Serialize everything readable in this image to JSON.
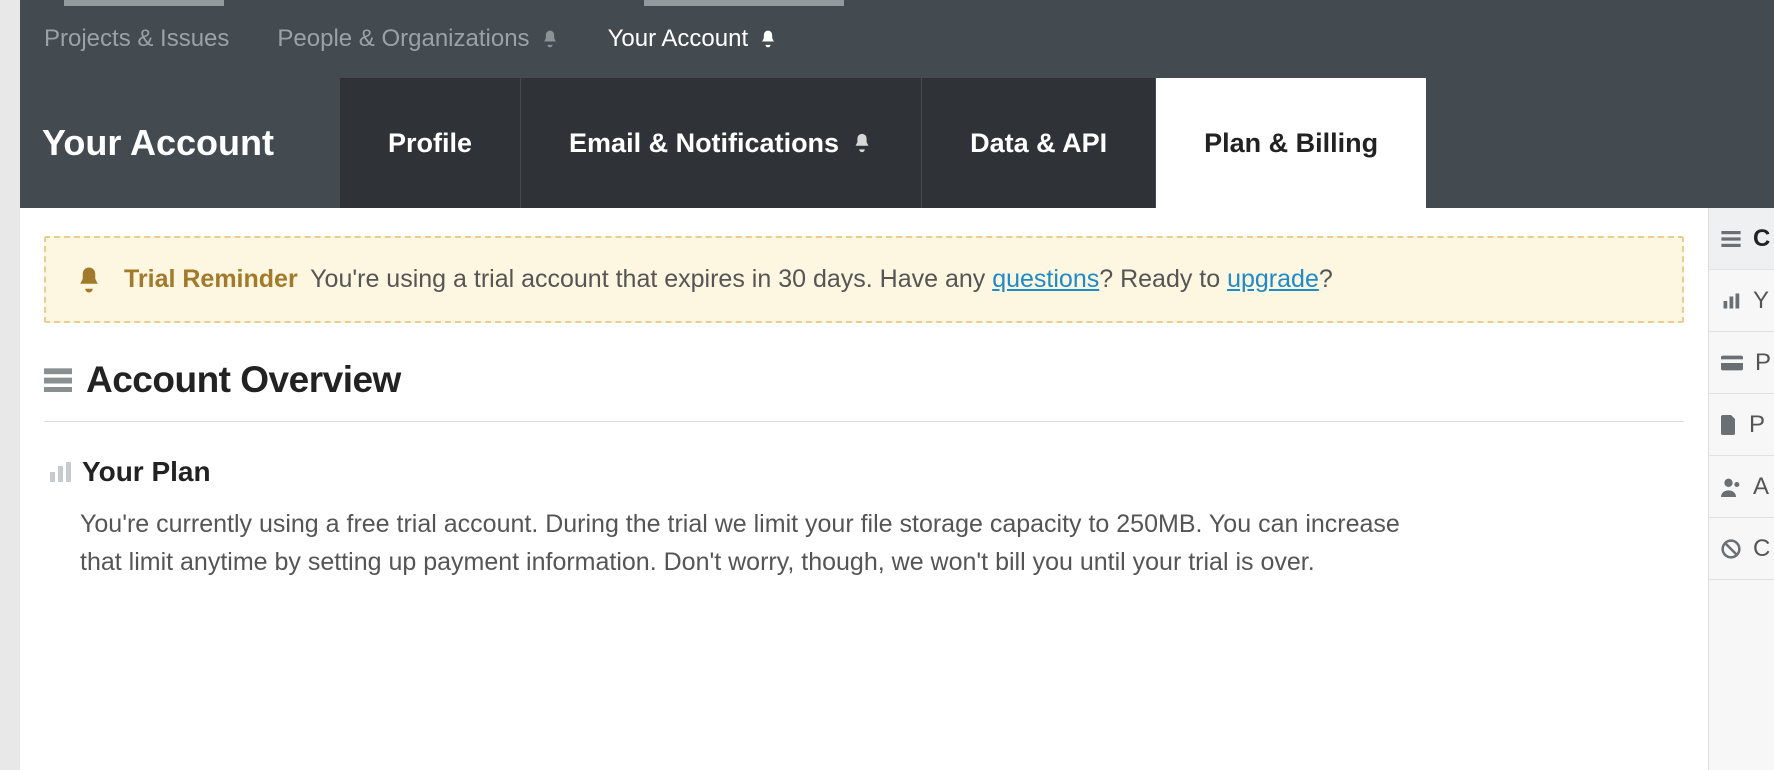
{
  "topnav": {
    "items": [
      {
        "label": "Projects & Issues",
        "has_bell": false,
        "active": false
      },
      {
        "label": "People & Organizations",
        "has_bell": true,
        "active": false
      },
      {
        "label": "Your Account",
        "has_bell": true,
        "active": true
      }
    ]
  },
  "page_title": "Your Account",
  "tabs": [
    {
      "label": "Profile",
      "has_bell": false,
      "active": false
    },
    {
      "label": "Email & Notifications",
      "has_bell": true,
      "active": false
    },
    {
      "label": "Data & API",
      "has_bell": false,
      "active": false
    },
    {
      "label": "Plan & Billing",
      "has_bell": false,
      "active": true
    }
  ],
  "banner": {
    "strong": "Trial Reminder",
    "text_before_q": "You're using a trial account that expires in 30 days. Have any ",
    "link_questions": "questions",
    "text_between": "? Ready to ",
    "link_upgrade": "upgrade",
    "text_after": "?"
  },
  "section": {
    "heading": "Account Overview",
    "sub_heading": "Your Plan",
    "plan_text": "You're currently using a free trial account. During the trial we limit your file storage capacity to 250MB. You can increase that limit anytime by setting up payment information. Don't worry, though, we won't bill you until your trial is over."
  },
  "right_sidebar": {
    "items": [
      {
        "icon": "menu",
        "letter": "C"
      },
      {
        "icon": "bars",
        "letter": "Y"
      },
      {
        "icon": "card",
        "letter": "P"
      },
      {
        "icon": "file",
        "letter": "P"
      },
      {
        "icon": "person",
        "letter": "A"
      },
      {
        "icon": "ban",
        "letter": "C"
      }
    ]
  }
}
